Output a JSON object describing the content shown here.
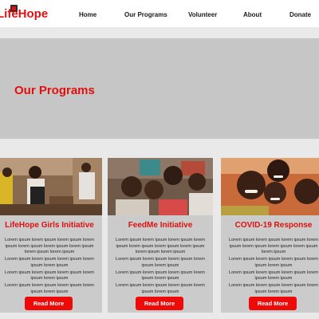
{
  "header": {
    "logo_text": "LifeHope",
    "nav": [
      {
        "label": "Home"
      },
      {
        "label": "Our Programs"
      },
      {
        "label": "Volunteer"
      },
      {
        "label": "About"
      },
      {
        "label": "Donate"
      }
    ]
  },
  "banner": {
    "title": "Our Programs"
  },
  "programs": [
    {
      "title": "LifeHope Girls Initiative",
      "paragraphs": [
        "Lorem ipsum lorem ipsum lorem ipsum lorem ipsum lorem ipsum lorem ipsum lorem ipsum lorem ipsum lorem ipsum",
        "Lorem ipsum lorem ipsum lorem ipsum lorem ipsum lorem ipsum",
        "Lorem ipsum lorem ipsum lorem ipsum lorem ipsum lorem ipsum",
        "Lorem ipsum lorem ipsum lorem ipsum lorem ipsum lorem ipsum"
      ],
      "button_label": "Read More"
    },
    {
      "title": "FeedMe Initiative",
      "paragraphs": [
        "Lorem ipsum lorem ipsum lorem ipsum lorem ipsum lorem ipsum lorem ipsum lorem ipsum lorem ipsum lorem ipsum",
        "Lorem ipsum lorem ipsum lorem ipsum lorem ipsum lorem ipsum",
        "Lorem ipsum lorem ipsum lorem ipsum lorem ipsum lorem ipsum",
        "Lorem ipsum lorem ipsum lorem ipsum lorem ipsum lorem ipsum"
      ],
      "button_label": "Read More"
    },
    {
      "title": "COVID-19 Response",
      "paragraphs": [
        "Lorem ipsum lorem ipsum lorem ipsum lorem ipsum lorem ipsum lorem ipsum lorem ipsum lorem ipsum",
        "Lorem ipsum lorem ipsum lorem ipsum lorem ipsum lorem ipsum",
        "Lorem ipsum lorem ipsum lorem ipsum lorem ipsum lorem ipsum",
        "Lorem ipsum lorem ipsum lorem ipsum lorem ipsum lorem ipsum"
      ],
      "button_label": "Read More"
    }
  ],
  "colors": {
    "brand_red": "#e10f0f",
    "button_red": "#ef0a0a",
    "banner_gray": "#c6c6c6",
    "card_gray": "#cbcbcb",
    "page_bg": "#e9e9e9"
  }
}
